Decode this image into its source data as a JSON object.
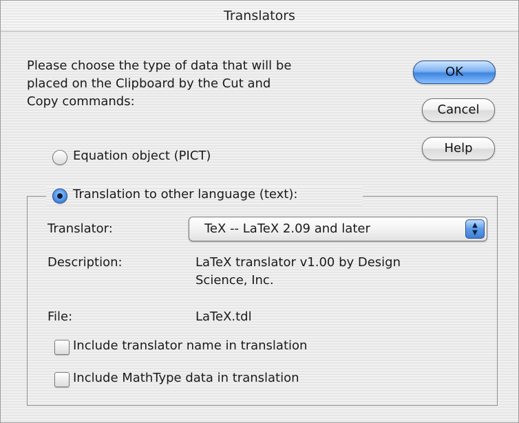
{
  "window": {
    "title": "Translators"
  },
  "intro_text": "Please choose the type of data that will be\nplaced on the Clipboard by the Cut and\nCopy commands:",
  "buttons": {
    "ok": "OK",
    "cancel": "Cancel",
    "help": "Help"
  },
  "options": {
    "equation": {
      "label": "Equation object (PICT)",
      "checked": false
    },
    "translation": {
      "label": "Translation to other language (text):",
      "checked": true
    }
  },
  "translator": {
    "label": "Translator:",
    "selected": "TeX -- LaTeX 2.09 and later"
  },
  "description": {
    "label": "Description:",
    "value_line1": "LaTeX translator v1.00 by Design",
    "value_line2": "Science, Inc."
  },
  "file": {
    "label": "File:",
    "value": "LaTeX.tdl"
  },
  "checkboxes": {
    "include_name": {
      "label": "Include translator name in translation",
      "checked": false
    },
    "include_mathtype": {
      "label": "Include MathType data in translation",
      "checked": false
    }
  },
  "colors": {
    "accent_blue": "#4a8fe6",
    "window_bg": "#ececec"
  },
  "icons": {
    "popup": "chevron-updown-icon"
  }
}
